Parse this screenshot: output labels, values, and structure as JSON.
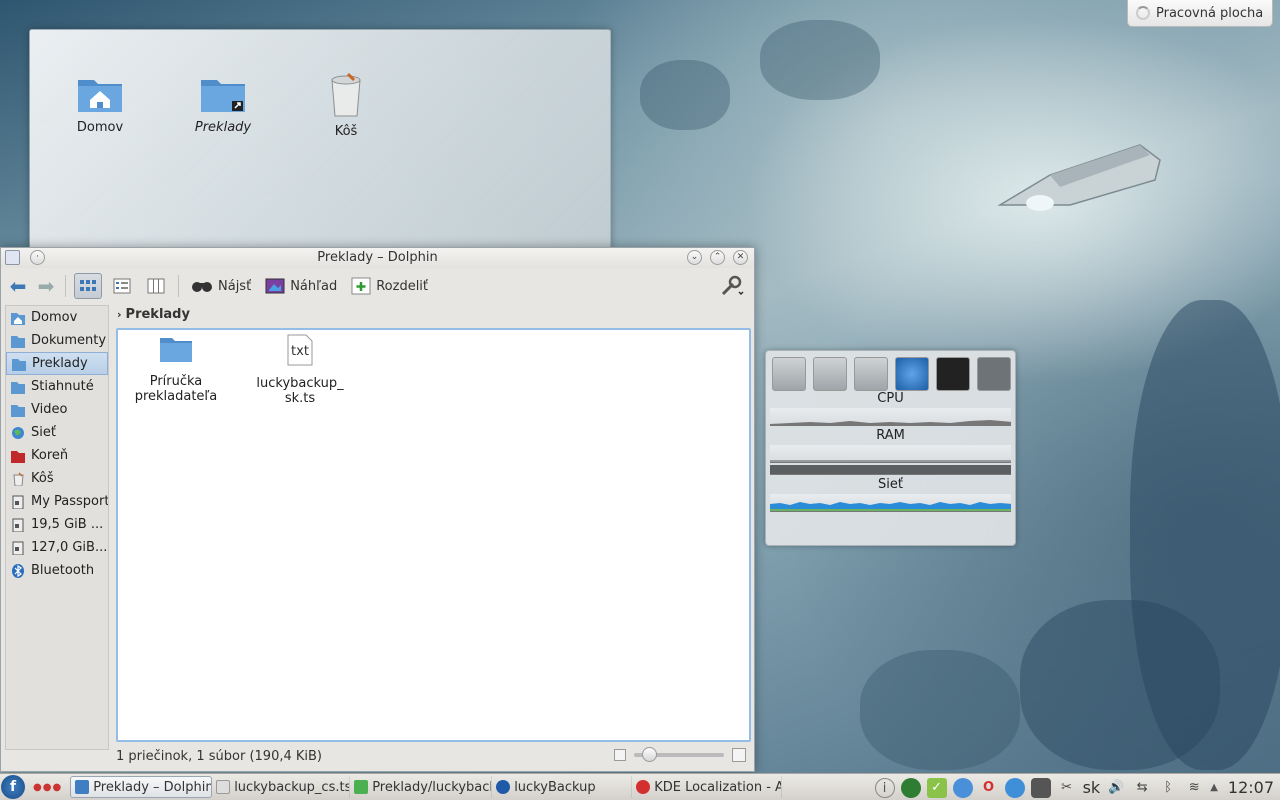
{
  "desktop": {
    "cashew_label": "Pracovná plocha",
    "folderview_items": [
      {
        "label": "Domov",
        "icon": "home-folder-icon",
        "italic": false
      },
      {
        "label": "Preklady",
        "icon": "folder-link-icon",
        "italic": true
      },
      {
        "label": "Kôš",
        "icon": "trash-icon",
        "italic": false
      }
    ]
  },
  "dolphin": {
    "title": "Preklady – Dolphin",
    "toolbar": {
      "find_label": "Nájsť",
      "preview_label": "Náhľad",
      "split_label": "Rozdeliť"
    },
    "places": [
      {
        "label": "Domov",
        "icon": "home-folder-icon",
        "selected": false
      },
      {
        "label": "Dokumenty",
        "icon": "folder-icon",
        "selected": false
      },
      {
        "label": "Preklady",
        "icon": "folder-icon",
        "selected": true
      },
      {
        "label": "Stiahnuté",
        "icon": "folder-icon",
        "selected": false
      },
      {
        "label": "Video",
        "icon": "folder-icon",
        "selected": false
      },
      {
        "label": "Sieť",
        "icon": "network-globe-icon",
        "selected": false
      },
      {
        "label": "Koreň",
        "icon": "root-folder-icon",
        "selected": false
      },
      {
        "label": "Kôš",
        "icon": "trash-icon",
        "selected": false
      },
      {
        "label": "My Passport",
        "icon": "drive-icon",
        "selected": false
      },
      {
        "label": "19,5 GiB ...",
        "icon": "drive-icon",
        "selected": false
      },
      {
        "label": "127,0 GiB...",
        "icon": "drive-icon",
        "selected": false
      },
      {
        "label": "Bluetooth",
        "icon": "bluetooth-icon",
        "selected": false
      }
    ],
    "breadcrumb": "Preklady",
    "files": [
      {
        "label": "Príručka prekladateľa",
        "type": "folder"
      },
      {
        "label": "luckybackup_ sk.ts",
        "type": "txt"
      }
    ],
    "txt_badge": "txt",
    "status": "1 priečinok, 1 súbor (190,4 KiB)",
    "zoom_fraction": 0.1
  },
  "sysmon": {
    "cpu_label": "CPU",
    "ram_label": "RAM",
    "net_label": "Sieť"
  },
  "taskbar": {
    "kickoff_glyph": "f",
    "tasks": [
      {
        "label": "Preklady – Dolphin",
        "active": true,
        "color": "#3f7fc1"
      },
      {
        "label": "luckybackup_cs.ts",
        "active": false,
        "color": "#999999"
      },
      {
        "label": "Preklady/luckyback",
        "active": false,
        "color": "#4caf50"
      },
      {
        "label": "luckyBackup",
        "active": false,
        "color": "#1e5aa8"
      },
      {
        "label": "KDE Localization - A",
        "active": false,
        "color": "#d32f2f"
      }
    ],
    "keyboard_layout": "sk",
    "clock": "12:07"
  }
}
